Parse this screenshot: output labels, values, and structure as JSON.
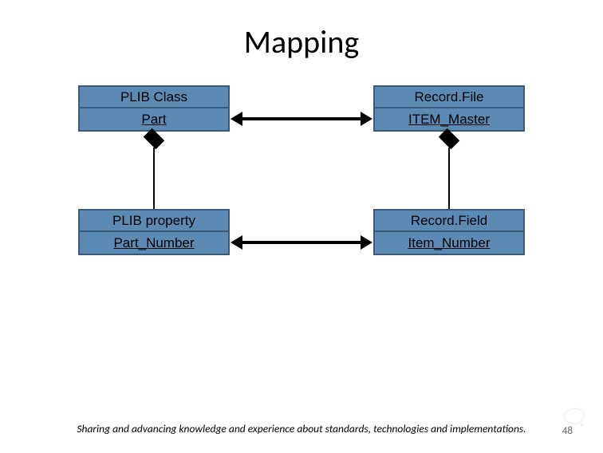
{
  "title": "Mapping",
  "boxes": {
    "topLeft": {
      "header": "PLIB Class",
      "body": "Part"
    },
    "topRight": {
      "header": "Record.File",
      "body": "ITEM_Master"
    },
    "botLeft": {
      "header": "PLIB property",
      "body": "Part_Number"
    },
    "botRight": {
      "header": "Record.Field",
      "body": "Item_Number"
    }
  },
  "footer": "Sharing and advancing knowledge and experience about standards, technologies and implementations.",
  "pageNumber": "48"
}
